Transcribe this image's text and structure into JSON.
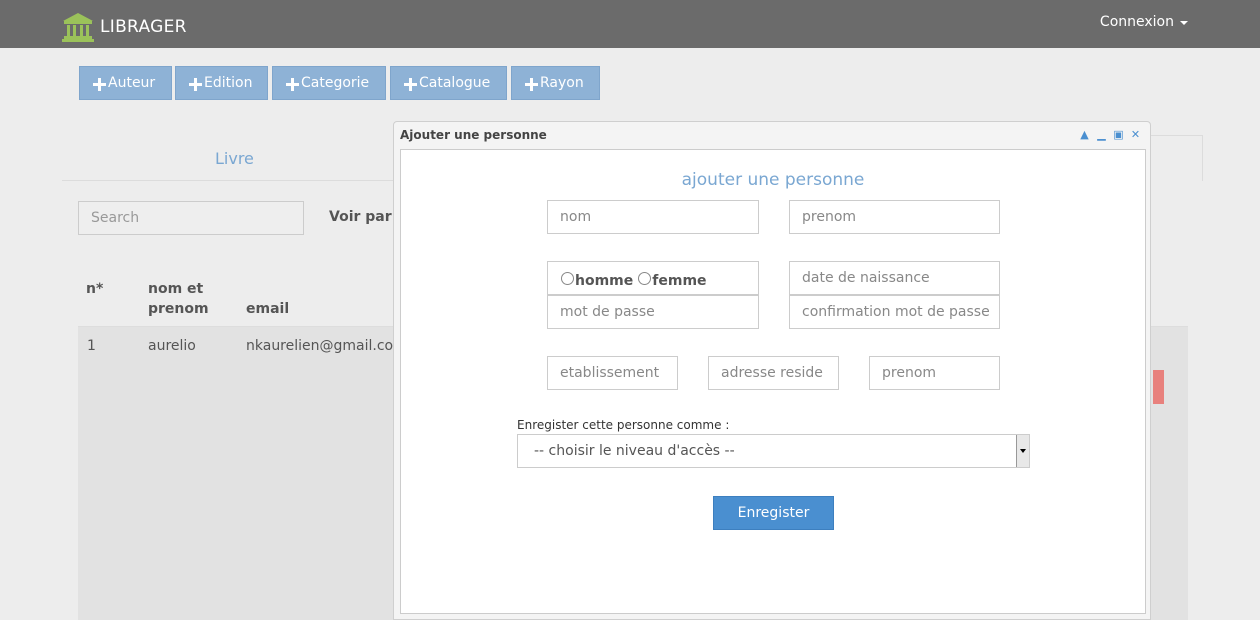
{
  "navbar": {
    "brand": "LIBRAGER",
    "brand_icon": "library-building-icon",
    "login_label": "Connexion"
  },
  "toolbar": {
    "buttons": [
      {
        "label": "Auteur",
        "icon": "plus-icon"
      },
      {
        "label": "Edition",
        "icon": "plus-icon"
      },
      {
        "label": "Categorie",
        "icon": "plus-icon"
      },
      {
        "label": "Catalogue",
        "icon": "plus-icon"
      },
      {
        "label": "Rayon",
        "icon": "plus-icon"
      }
    ]
  },
  "tabs": {
    "active": "Livre"
  },
  "filters": {
    "search_placeholder": "Search",
    "voir_par": "Voir par"
  },
  "table": {
    "headers": {
      "num": "n*",
      "name_line1": "nom et",
      "name_line2": "prenom",
      "email": "email"
    },
    "rows": [
      {
        "num": "1",
        "name": "aurelio",
        "email": "nkaurelien@gmail.com"
      }
    ]
  },
  "modal": {
    "title": "Ajouter une personne",
    "form_title": "ajouter une personne",
    "placeholders": {
      "nom": "nom",
      "prenom": "prenom",
      "date_naissance": "date de naissance",
      "mot_de_passe": "mot de passe",
      "confirmation": "confirmation mot de passe",
      "etablissement": "etablissement",
      "adresse": "adresse reside",
      "prenom2": "prenom"
    },
    "gender": {
      "male": "homme",
      "female": "femme"
    },
    "access_label": "Enregister cette personne comme :",
    "access_selected": "-- choisir le niveau d'accès --",
    "submit": "Enregister"
  },
  "colors": {
    "navbar": "#6b6b6b",
    "toolbar_button": "#8eb2d6",
    "primary": "#4a8fd0",
    "accent_text": "#7aa7d2",
    "danger": "#e8817d"
  }
}
